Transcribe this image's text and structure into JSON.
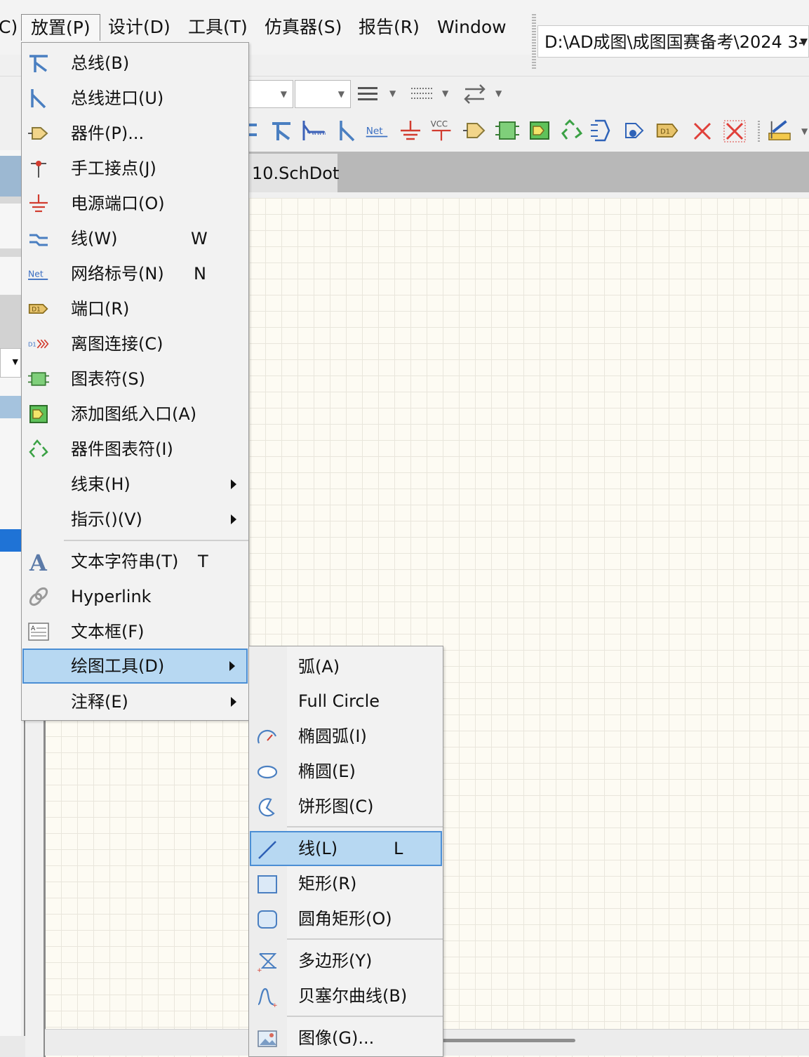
{
  "menubar": {
    "partial_left": "C)",
    "items": [
      "放置(P)",
      "设计(D)",
      "工具(T)",
      "仿真器(S)",
      "报告(R)",
      "Window"
    ]
  },
  "path": "D:\\AD成图\\成图国赛备考\\2024 3-",
  "tab": {
    "label": "10.SchDot"
  },
  "place_menu": {
    "items": [
      {
        "label": "总线(B)",
        "icon": "bus-icon"
      },
      {
        "label": "总线进口(U)",
        "icon": "bus-entry-icon"
      },
      {
        "label": "器件(P)...",
        "icon": "part-icon"
      },
      {
        "label": "手工接点(J)",
        "icon": "junction-icon"
      },
      {
        "label": "电源端口(O)",
        "icon": "power-port-icon"
      },
      {
        "label": "线(W)",
        "key": "W",
        "icon": "wire-icon"
      },
      {
        "label": "网络标号(N)",
        "key": "N",
        "icon": "net-label-icon"
      },
      {
        "label": "端口(R)",
        "icon": "port-icon"
      },
      {
        "label": "离图连接(C)",
        "icon": "off-sheet-connector-icon"
      },
      {
        "label": "图表符(S)",
        "icon": "sheet-symbol-icon"
      },
      {
        "label": "添加图纸入口(A)",
        "icon": "sheet-entry-icon"
      },
      {
        "label": "器件图表符(I)",
        "icon": "device-sheet-symbol-icon"
      },
      {
        "label": "线束(H)"
      },
      {
        "label": "指示()(V)"
      },
      {
        "label": "文本字符串(T)",
        "key": "T",
        "icon": "text-string-icon"
      },
      {
        "label": "Hyperlink",
        "icon": "hyperlink-icon"
      },
      {
        "label": "文本框(F)",
        "icon": "text-frame-icon"
      },
      {
        "label": "绘图工具(D)"
      },
      {
        "label": "注释(E)"
      }
    ]
  },
  "drawing_tools_menu": {
    "items": [
      {
        "label": "弧(A)"
      },
      {
        "label": "Full Circle"
      },
      {
        "label": "椭圆弧(I)",
        "icon": "elliptical-arc-icon"
      },
      {
        "label": "椭圆(E)",
        "icon": "ellipse-icon"
      },
      {
        "label": "饼形图(C)",
        "icon": "pie-chart-icon"
      },
      {
        "label": "线(L)",
        "key": "L",
        "icon": "line-icon"
      },
      {
        "label": "矩形(R)",
        "icon": "rectangle-icon"
      },
      {
        "label": "圆角矩形(O)",
        "icon": "round-rectangle-icon"
      },
      {
        "label": "多边形(Y)",
        "icon": "polygon-icon"
      },
      {
        "label": "贝塞尔曲线(B)",
        "icon": "bezier-icon"
      },
      {
        "label": "图像(G)...",
        "icon": "image-icon"
      }
    ]
  },
  "colors": {
    "highlight": "#b7d8f2",
    "highlight_border": "#4b8ed4"
  }
}
